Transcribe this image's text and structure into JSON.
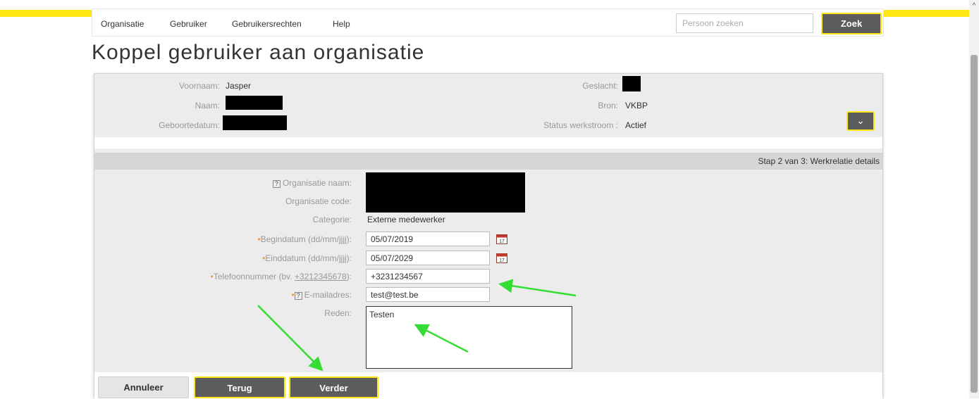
{
  "nav": {
    "items": [
      "Organisatie",
      "Gebruiker",
      "Gebruikersrechten",
      "Help"
    ],
    "search_placeholder": "Persoon zoeken",
    "search_button": "Zoek"
  },
  "page_title": "Koppel gebruiker aan organisatie",
  "person": {
    "voornaam_label": "Voornaam:",
    "voornaam_value": "Jasper",
    "naam_label": "Naam:",
    "geboortedatum_label": "Geboortedatum:",
    "geslacht_label": "Geslacht:",
    "bron_label": "Bron:",
    "bron_value": "VKBP",
    "status_label": "Status werkstroom :",
    "status_value": "Actief"
  },
  "step_label": "Stap 2 van 3: Werkrelatie details",
  "form": {
    "org_naam_label": "Organisatie naam:",
    "org_code_label": "Organisatie code:",
    "categorie_label": "Categorie:",
    "categorie_value": "Externe medewerker",
    "begindatum_label": "Begindatum (dd/mm/jjjj):",
    "begindatum_value": "05/07/2019",
    "einddatum_label": "Einddatum (dd/mm/jjjj):",
    "einddatum_value": "05/07/2029",
    "telefoon_label": "Telefoonnummer (bv. ",
    "telefoon_example": "+3212345678",
    "telefoon_label_end": "):",
    "telefoon_value": "+3231234567",
    "email_label": "E-mailadres:",
    "email_value": "test@test.be",
    "reden_label": "Reden:",
    "reden_value": "Testen",
    "help_mark": "?",
    "required_mark": "•",
    "calendar_day": "17"
  },
  "buttons": {
    "annuleer": "Annuleer",
    "terug": "Terug",
    "verder": "Verder"
  },
  "colors": {
    "accent_yellow": "#ffe615",
    "button_dark": "#5c5c5c",
    "arrow_green": "#33dd33",
    "required_orange": "#f39c2c"
  },
  "icons": {
    "calendar": "calendar-icon",
    "toggle": "chevron-down-icon",
    "scroll_up": "chevron-up-icon"
  },
  "scroll_up_glyph": "^",
  "toggle_glyph": "⌄"
}
